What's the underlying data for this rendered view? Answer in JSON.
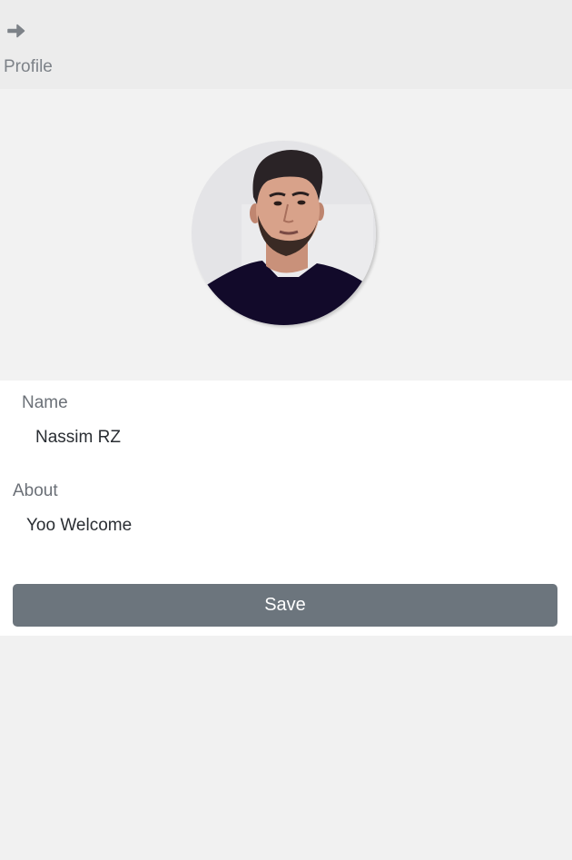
{
  "header": {
    "back_icon": "arrow-right-icon",
    "title": "Profile"
  },
  "profile": {
    "avatar_icon": "profile-photo"
  },
  "form": {
    "name_label": "Name",
    "name_value": "Nassim RZ",
    "about_label": "About",
    "about_value": "Yoo Welcome",
    "save_label": "Save"
  },
  "colors": {
    "header_bg": "#ececec",
    "body_bg": "#f1f1f1",
    "button_bg": "#6c757d",
    "icon": "#7d8288"
  }
}
